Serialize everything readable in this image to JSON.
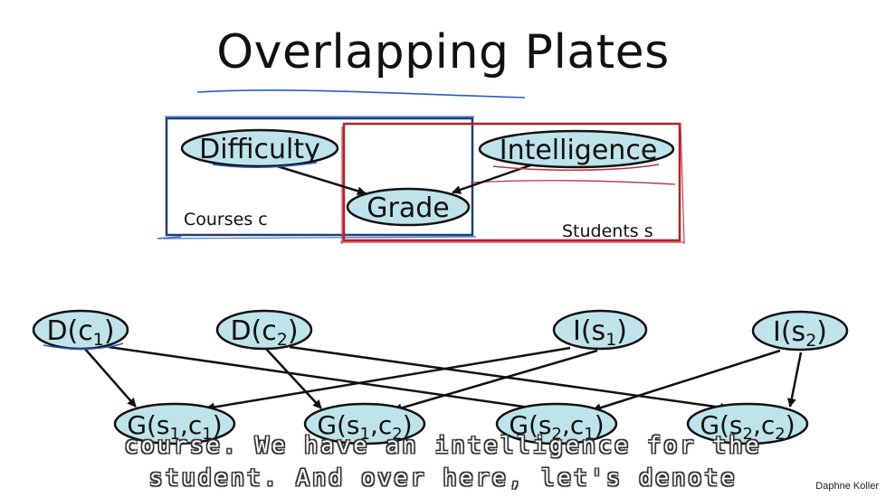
{
  "title": "Overlapping Plates",
  "plates": {
    "courses": "Courses c",
    "students": "Students s"
  },
  "template_nodes": {
    "difficulty": "Difficulty",
    "intelligence": "Intelligence",
    "grade": "Grade"
  },
  "ground_nodes": {
    "d1": {
      "base": "D(c",
      "sub": "1",
      "end": ")"
    },
    "d2": {
      "base": "D(c",
      "sub": "2",
      "end": ")"
    },
    "i1": {
      "base": "I(s",
      "sub": "1",
      "end": ")"
    },
    "i2": {
      "base": "I(s",
      "sub": "2",
      "end": ")"
    },
    "g11": {
      "base": "G(s",
      "sub1": "1",
      "mid": ",c",
      "sub2": "1",
      "end": ")"
    },
    "g12": {
      "base": "G(s",
      "sub1": "1",
      "mid": ",c",
      "sub2": "2",
      "end": ")"
    },
    "g21": {
      "base": "G(s",
      "sub1": "2",
      "mid": ",c",
      "sub2": "1",
      "end": ")"
    },
    "g22": {
      "base": "G(s",
      "sub1": "2",
      "mid": ",c",
      "sub2": "2",
      "end": ")"
    }
  },
  "subtitles": {
    "line1": "course. We have an intelligence for the",
    "line2": "student. And over here, let's denote"
  },
  "attribution": "Daphne Koller",
  "colors": {
    "node_fill": "#bfe3ea",
    "courses_plate": "#1f3f7a",
    "students_plate": "#b0202a",
    "underline_blue": "#2a5ec9",
    "underline_red": "#c0303a"
  }
}
